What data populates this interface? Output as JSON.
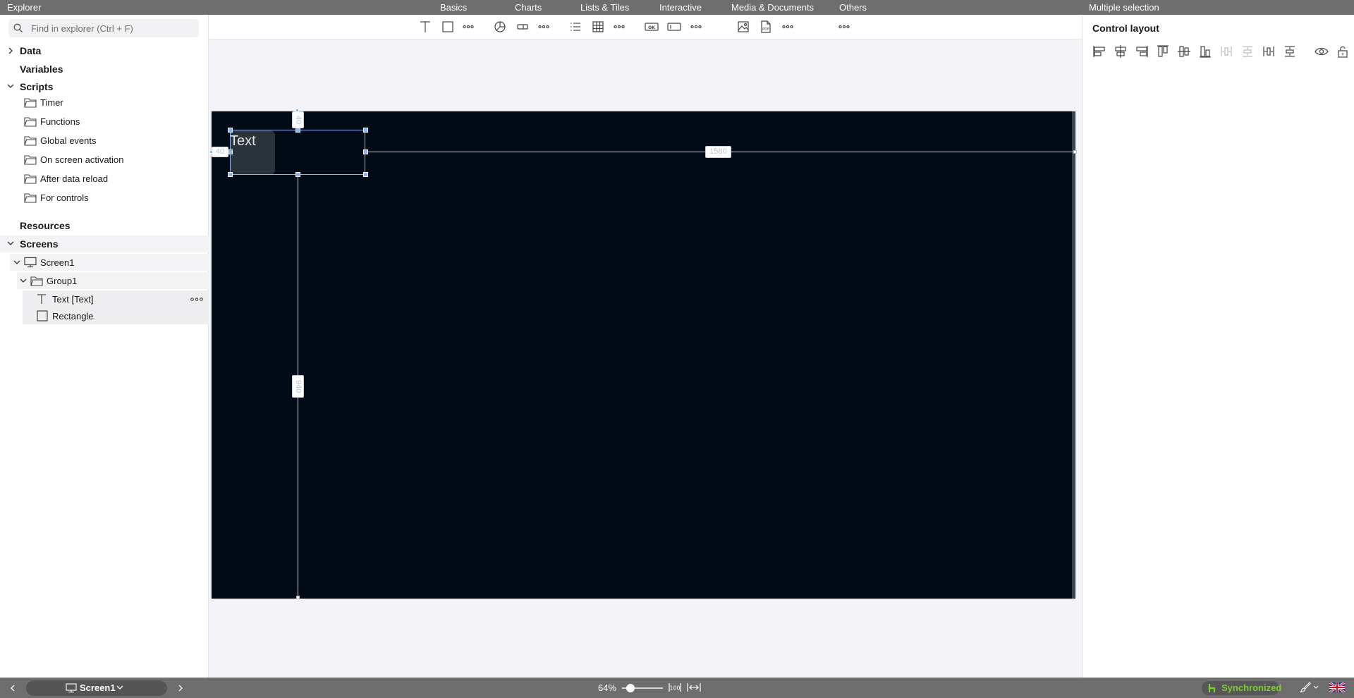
{
  "topbar": {
    "title": "Explorer",
    "tabs": [
      "Basics",
      "Charts",
      "Lists & Tiles",
      "Interactive",
      "Media & Documents",
      "Others"
    ],
    "selection_label": "Multiple selection"
  },
  "explorer": {
    "search_placeholder": "Find in explorer (Ctrl + F)",
    "sections": {
      "data": "Data",
      "variables": "Variables",
      "scripts": "Scripts",
      "resources": "Resources",
      "screens": "Screens"
    },
    "script_folders": [
      "Timer",
      "Functions",
      "Global events",
      "On screen activation",
      "After data reload",
      "For controls"
    ],
    "screens": {
      "screen1": "Screen1",
      "group1": "Group1",
      "text_item": "Text [Text]",
      "rect_item": "Rectangle"
    }
  },
  "canvas": {
    "text_content": "Text",
    "dim_top": "40",
    "dim_left": "40",
    "dim_right": "1580",
    "dim_bottom": "940"
  },
  "props": {
    "title": "Control layout"
  },
  "bottombar": {
    "current_screen": "Screen1",
    "zoom": "64%",
    "zoom_fraction": 0.2,
    "sync_status": "Synchronized"
  },
  "colors": {
    "canvas_bg": "#020b15",
    "selection": "#8ab4f0",
    "sync_green": "#7bd02c",
    "chrome_gray": "#6e6e6e"
  },
  "icons": {
    "insert_toolbar": [
      "text-icon",
      "rectangle-icon",
      "more-icon",
      "pie-chart-icon",
      "bar-icon",
      "more-icon",
      "list-icon",
      "table-icon",
      "more-icon",
      "button-icon",
      "input-icon",
      "more-icon",
      "image-icon",
      "pdf-icon",
      "more-icon",
      "more-icon"
    ],
    "layout_tools": [
      "align-left-icon",
      "align-center-h-icon",
      "align-right-icon",
      "align-top-icon",
      "align-middle-icon",
      "align-bottom-icon",
      "distribute-h-icon",
      "distribute-v-icon",
      "space-h-icon",
      "space-v-icon",
      "eye-icon",
      "lock-icon"
    ]
  }
}
